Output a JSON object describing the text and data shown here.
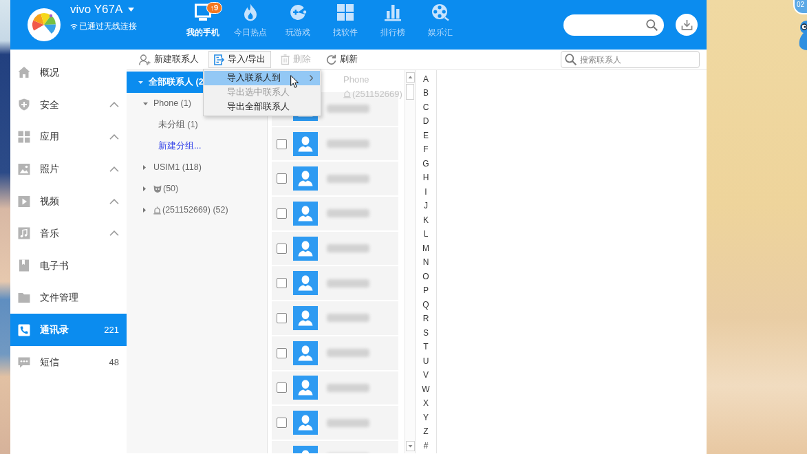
{
  "device": {
    "name": "vivo Y67A",
    "connection": "已通过无线连接"
  },
  "top_nav": [
    {
      "label": "我的手机",
      "selected": true,
      "badge": "↑9"
    },
    {
      "label": "今日热点",
      "selected": false
    },
    {
      "label": "玩游戏",
      "selected": false
    },
    {
      "label": "找软件",
      "selected": false
    },
    {
      "label": "排行榜",
      "selected": false
    },
    {
      "label": "娱乐汇",
      "selected": false
    }
  ],
  "sidebar": [
    {
      "label": "概况",
      "selected": false,
      "expandable": false
    },
    {
      "label": "安全",
      "selected": false,
      "expandable": true
    },
    {
      "label": "应用",
      "selected": false,
      "expandable": true
    },
    {
      "label": "照片",
      "selected": false,
      "expandable": true
    },
    {
      "label": "视频",
      "selected": false,
      "expandable": true
    },
    {
      "label": "音乐",
      "selected": false,
      "expandable": true
    },
    {
      "label": "电子书",
      "selected": false,
      "expandable": false
    },
    {
      "label": "文件管理",
      "selected": false,
      "expandable": false
    },
    {
      "label": "通讯录",
      "selected": true,
      "expandable": false,
      "count": "221"
    },
    {
      "label": "短信",
      "selected": false,
      "expandable": false,
      "count": "48"
    }
  ],
  "toolbar": {
    "buttons": [
      {
        "label": "新建联系人",
        "pressed": false,
        "disabled": false
      },
      {
        "label": "导入/导出",
        "pressed": true,
        "disabled": false
      },
      {
        "label": "删除",
        "pressed": false,
        "disabled": true
      },
      {
        "label": "刷新",
        "pressed": false,
        "disabled": false
      }
    ],
    "search": {
      "placeholder": "搜索联系人"
    }
  },
  "groups": [
    {
      "kind": "group",
      "label": "全部联系人 (2",
      "selected": true,
      "expanded": true,
      "children": [
        {
          "kind": "group",
          "label": "Phone (1)",
          "selected": false,
          "expanded": true,
          "children": [
            {
              "kind": "group",
              "label": "未分组 (1)",
              "selected": false
            },
            {
              "kind": "link",
              "label": "新建分组...",
              "selected": false
            }
          ]
        },
        {
          "kind": "group",
          "label": "USIM1 (118)",
          "selected": false,
          "expanded": false
        },
        {
          "kind": "face",
          "label": "(50)",
          "selected": false,
          "expanded": false
        },
        {
          "kind": "bell",
          "label": "(251152669) (52)",
          "selected": false,
          "expanded": false
        }
      ]
    }
  ],
  "menu": {
    "items": [
      {
        "label": "导入联系人到",
        "selected": true,
        "disabled": false,
        "submenu": true
      },
      {
        "label": "导出选中联系人",
        "selected": false,
        "disabled": true,
        "submenu": false
      },
      {
        "label": "导出全部联系人",
        "selected": false,
        "disabled": false,
        "submenu": false
      }
    ]
  },
  "contact_list": {
    "faded_labels": [
      {
        "kind": "group",
        "text": "Phone"
      },
      {
        "kind": "bell",
        "text": "(251152669)"
      }
    ],
    "rows": [
      {
        "kind": "partial"
      },
      {
        "kind": "contact",
        "checked": false
      },
      {
        "kind": "contact",
        "checked": false
      },
      {
        "kind": "contact",
        "checked": false
      },
      {
        "kind": "contact",
        "checked": false
      },
      {
        "kind": "contact",
        "checked": false
      },
      {
        "kind": "contact",
        "checked": false
      },
      {
        "kind": "contact",
        "checked": false
      },
      {
        "kind": "contact",
        "checked": false
      },
      {
        "kind": "contact",
        "checked": false
      },
      {
        "kind": "partial"
      }
    ]
  },
  "alphabet_index": [
    "A",
    "B",
    "C",
    "D",
    "E",
    "F",
    "G",
    "H",
    "I",
    "J",
    "K",
    "L",
    "M",
    "N",
    "O",
    "P",
    "Q",
    "R",
    "S",
    "T",
    "U",
    "V",
    "W",
    "X",
    "Y",
    "Z",
    "#"
  ],
  "desktop": {
    "clock": "02"
  }
}
